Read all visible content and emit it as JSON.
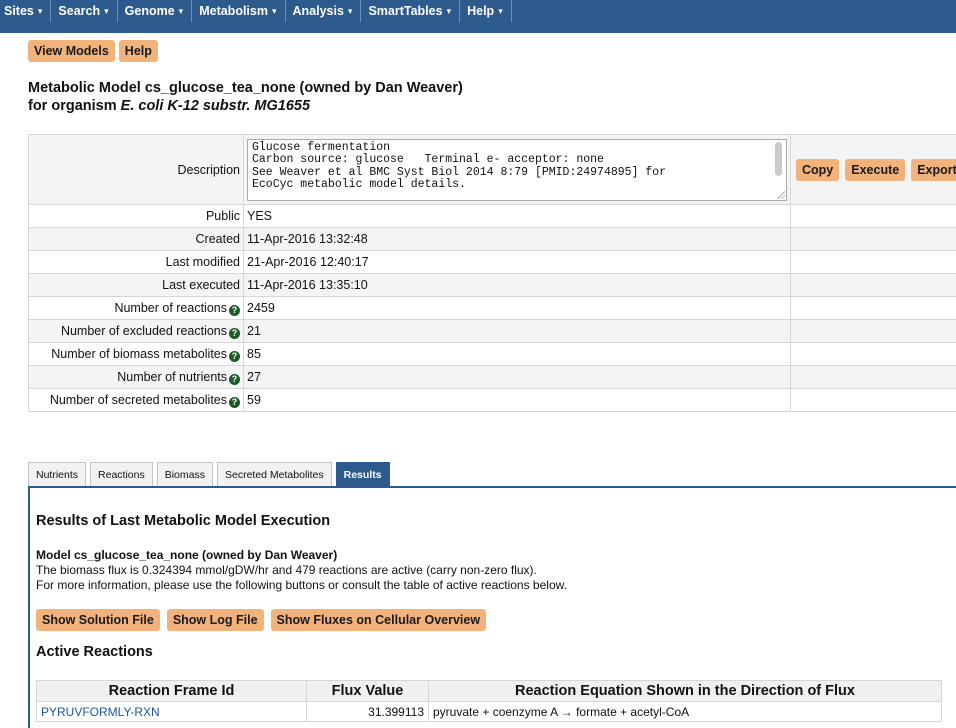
{
  "nav": {
    "items": [
      "Sites",
      "Search",
      "Genome",
      "Metabolism",
      "Analysis",
      "SmartTables",
      "Help"
    ],
    "caret": "▾"
  },
  "top_buttons": {
    "view_models": "View Models",
    "help": "Help"
  },
  "title": {
    "line1": "Metabolic Model cs_glucose_tea_none (owned by Dan Weaver)",
    "line2_prefix": "for organism ",
    "organism": "E. coli K-12 substr. MG1655"
  },
  "info": {
    "description_label": "Description",
    "description_text": "Glucose fermentation\nCarbon source: glucose   Terminal e- acceptor: none\nSee Weaver et al BMC Syst Biol 2014 8:79 [PMID:24974895] for\nEcoCyc metabolic model details.",
    "actions": {
      "copy": "Copy",
      "execute": "Execute",
      "export": "Export"
    },
    "rows": [
      {
        "label": "Public",
        "value": "YES",
        "help": false
      },
      {
        "label": "Created",
        "value": "11-Apr-2016 13:32:48",
        "help": false
      },
      {
        "label": "Last modified",
        "value": "21-Apr-2016 12:40:17",
        "help": false
      },
      {
        "label": "Last executed",
        "value": "11-Apr-2016 13:35:10",
        "help": false
      },
      {
        "label": "Number of reactions",
        "value": "2459",
        "help": true
      },
      {
        "label": "Number of excluded reactions",
        "value": "21",
        "help": true
      },
      {
        "label": "Number of biomass metabolites",
        "value": "85",
        "help": true
      },
      {
        "label": "Number of nutrients",
        "value": "27",
        "help": true
      },
      {
        "label": "Number of secreted metabolites",
        "value": "59",
        "help": true
      }
    ],
    "help_glyph": "?"
  },
  "tabs": {
    "items": [
      "Nutrients",
      "Reactions",
      "Biomass",
      "Secreted Metabolites",
      "Results"
    ],
    "active": "Results"
  },
  "results": {
    "title": "Results of Last Metabolic Model Execution",
    "model_line": "Model cs_glucose_tea_none (owned by Dan Weaver)",
    "flux_line": "The biomass flux is 0.324394 mmol/gDW/hr and 479 reactions are active (carry non-zero flux).",
    "info_line": "For more information, please use the following buttons or consult the table of active reactions below.",
    "buttons": {
      "solution": "Show Solution File",
      "log": "Show Log File",
      "fluxes": "Show Fluxes on Cellular Overview"
    },
    "active_title": "Active Reactions",
    "table": {
      "headers": [
        "Reaction Frame Id",
        "Flux Value",
        "Reaction Equation Shown in the Direction of Flux"
      ],
      "rows": [
        {
          "id": "PYRUVFORMLY-RXN",
          "flux": "31.399113",
          "equation": "pyruvate + coenzyme A → formate + acetyl-CoA"
        }
      ]
    }
  },
  "colors": {
    "nav_bg": "#2c5a8c",
    "button_bg": "#f2b27b",
    "link": "#1d54a0",
    "help_icon": "#1e5a25"
  }
}
